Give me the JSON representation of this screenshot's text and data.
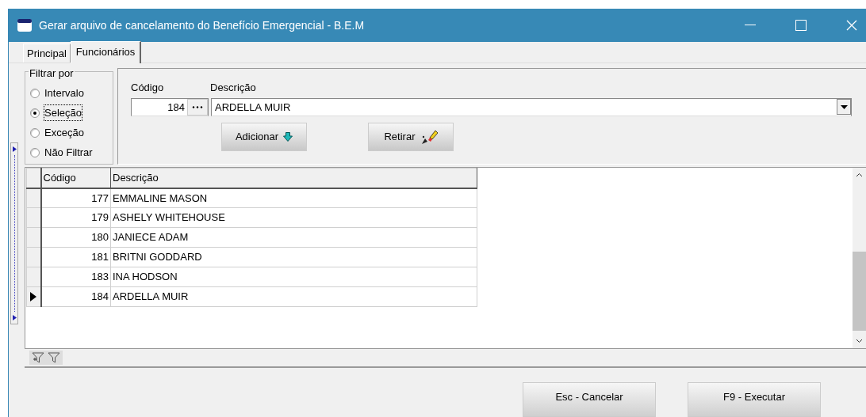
{
  "window": {
    "title": "Gerar arquivo de cancelamento do Benefício Emergencial - B.E.M"
  },
  "tabs": [
    {
      "label": "Principal",
      "selected": false
    },
    {
      "label": "Funcionários",
      "selected": true
    }
  ],
  "filter": {
    "legend": "Filtrar por",
    "options": [
      {
        "label": "Intervalo",
        "selected": false
      },
      {
        "label": "Seleção",
        "selected": true
      },
      {
        "label": "Exceção",
        "selected": false
      },
      {
        "label": "Não Filtrar",
        "selected": false
      }
    ]
  },
  "selection": {
    "code_label": "Código",
    "code_value": "184",
    "description_label": "Descrição",
    "description_value": "ARDELLA MUIR"
  },
  "actions": [
    {
      "label": "Adicionar",
      "kind": "add"
    },
    {
      "label": "Retirar",
      "kind": "remove"
    }
  ],
  "grid": {
    "columns": [
      "Código",
      "Descrição"
    ],
    "rows": [
      {
        "code": "177",
        "name": "EMMALINE MASON",
        "selected": false
      },
      {
        "code": "179",
        "name": "ASHELY WHITEHOUSE",
        "selected": false
      },
      {
        "code": "180",
        "name": "JANIECE ADAM",
        "selected": false
      },
      {
        "code": "181",
        "name": "BRITNI GODDARD",
        "selected": false
      },
      {
        "code": "183",
        "name": "INA HODSON",
        "selected": false
      },
      {
        "code": "184",
        "name": "ARDELLA MUIR",
        "selected": true
      }
    ]
  },
  "buttons": [
    "Esc - Cancelar",
    "F9 - Executar"
  ]
}
